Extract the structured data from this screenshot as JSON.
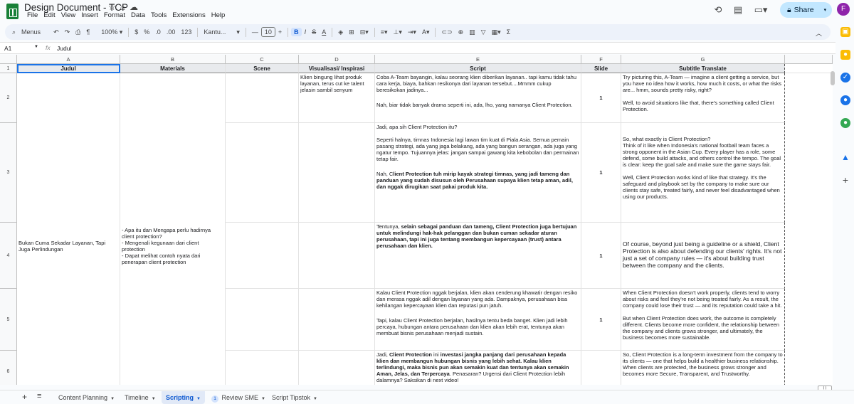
{
  "app": {
    "title": "Design Document - TCP",
    "menu": [
      "File",
      "Edit",
      "View",
      "Insert",
      "Format",
      "Data",
      "Tools",
      "Extensions",
      "Help"
    ],
    "share_label": "Share",
    "avatar_letter": "F"
  },
  "toolbar": {
    "menus_label": "Menus",
    "zoom": "100%",
    "currency": "$",
    "percent": "%",
    "dec_decrease": ".0",
    "dec_increase": ".00",
    "number_format": "123",
    "font_name": "Kantu...",
    "font_size": "10",
    "minus": "—",
    "plus": "+",
    "bold": "B",
    "italic": "I",
    "strike": "S",
    "textcolor": "A",
    "sigma": "Σ"
  },
  "formula_bar": {
    "cell_ref": "A1",
    "fx": "fx",
    "value": "Judul"
  },
  "columns": [
    "A",
    "B",
    "C",
    "D",
    "E",
    "F",
    "G"
  ],
  "headers": [
    "Judul",
    "Materials",
    "Scene",
    "Visualisasi/ Inspirasi",
    "Script",
    "Slide",
    "Subtitle Translate"
  ],
  "rows": [
    "1",
    "2",
    "3",
    "4",
    "5",
    "6"
  ],
  "cells": {
    "a_judul": "Bukan Cuma Sekadar Layanan, Tapi Juga Perlindungan",
    "b_materials": "- Apa itu dan Mengapa perlu hadirnya client protection?\n- Mengenali kegunaan dari client protection\n- Dapat melihat contoh nyata dari penerapan client protection",
    "d_visual": "Klien bingung lihat produk layanan, terus cut ke talent jelasin sambil senyum",
    "r2_script_p1": "Coba A-Team bayangin, kalau seorang klien diberikan layanan.. tapi kamu tidak tahu cara kerja, biaya, bahkan resikonya dari layanan tersebut....Mmmm cukup beresikokan jadinya...",
    "r2_script_p2": "Nah, biar tidak banyak drama seperti ini, ada, lho, yang namanya Client Protection.",
    "r2_slide": "1",
    "r2_sub_p1": "Try picturing this, A-Team — imagine a client getting a service, but you have no idea how it works, how much it costs, or what the risks are... hmm, sounds pretty risky, right?",
    "r2_sub_p2": "Well, to avoid situations like that, there's something called Client Protection.",
    "r3_script_p1": "Jadi, apa sih Client Protection itu?",
    "r3_script_p2": "Seperti halnya, timnas Indonesia lagi lawan tim kuat di Piala Asia. Semua pemain pasang strategi, ada yang jaga belakang, ada yang bangun serangan, ada juga yang ngatur tempo. Tujuannya jelas: jangan sampai gawang kita kebobolan dan permainan tetap fair.",
    "r3_script_p3a": "Nah, C",
    "r3_script_p3b": "lient Protection tuh mirip kayak strategi timnas, yang jadi tameng dan panduan yang sudah disusun oleh Perusahaan supaya klien tetap aman, adil, dan nggak dirugikan saat pakai produk kita.",
    "r3_slide": "1",
    "r3_sub_p1": "So, what exactly is Client Protection?\nThink of it like when Indonesia's national football team faces a strong opponent in the Asian Cup. Every player has a role, some defend, some build attacks, and others control the tempo. The goal is clear: keep the goal safe and make sure the game stays fair.",
    "r3_sub_p2": "Well, Client Protection works kind of like that strategy. It's the safeguard and playbook set by the company to make sure our clients stay safe, treated fairly, and never feel disadvantaged when using our products.",
    "r4_script_a": "Tentunya, ",
    "r4_script_b": "selain sebagai panduan dan tameng, Client Protection juga bertujuan untuk melindungi hak-hak pelanggan dan bukan cuman sekadar aturan perusahaan, tapi ini juga tentang membangun kepercayaan (trust) antara perusahaan dan klien.",
    "r4_slide": "1",
    "r4_sub": "Of course, beyond just being a guideline or a shield, Client Protection is also about defending our clients' rights. It's not just a set of company rules — it's about building trust between the company and the clients.",
    "r5_script_p1": "Kalau Client Protection nggak berjalan, klien akan cenderung khawatir dengan resiko dan merasa nggak adil dengan layanan yang ada. Dampaknya, perusahaan bisa kehilangan kepercayaan klien dan reputasi pun jatuh.",
    "r5_script_p2": "Tapi, kalau Client Protection berjalan, hasilnya tentu beda banget. Klien jadi lebih percaya, hubungan antara perusahaan dan klien akan lebih erat, tentunya akan membuat bisnis perusahaan menjadi sustain.",
    "r5_slide": "1",
    "r5_sub_p1": "When Client Protection doesn't work properly, clients tend to worry about risks and feel they're not being treated fairly. As a result, the company could lose their trust — and its reputation could take a hit.",
    "r5_sub_p2": "But when Client Protection does work, the outcome is completely different. Clients become more confident, the relationship between the company and clients grows stronger, and ultimately, the business becomes more sustainable.",
    "r6_script_a": "Jadi, ",
    "r6_script_b": "Client Protection",
    "r6_script_c": " ini ",
    "r6_script_d": "investasi jangka panjang dari perusahaan kepada klien dan membangun hubungan bisnis yang lebih sehat. Kalau klien terlindungi, maka bisnis pun akan semakin kuat dan tentunya akan semakin Aman, Jelas, dan Terpercaya",
    "r6_script_e": ". Penasaran? Urgensi dari Client Protection lebih dalamnya? Saksikan di next video!",
    "r6_slide": "1",
    "r6_sub": "So, Client Protection is a long-term investment from the company to its clients — one that helps build a healthier business relationship. When clients are protected, the business grows stronger and becomes more Secure, Transparent, and Trustworthy."
  },
  "sheets": {
    "add": "+",
    "list": "≡",
    "tabs": [
      {
        "label": "Content Planning"
      },
      {
        "label": "Timeline"
      },
      {
        "label": "Scripting"
      },
      {
        "label": "Review SME",
        "badge": "1"
      },
      {
        "label": "Script Tipstok"
      }
    ]
  },
  "colors": {
    "accent": "#1a73e8",
    "share_bg": "#c2e7ff",
    "sheets_green": "#188038",
    "avatar": "#8e24aa"
  },
  "icons": [
    "star-icon",
    "move-icon",
    "cloud-status-icon",
    "history-icon",
    "comments-icon",
    "meet-icon",
    "search-icon",
    "undo-icon",
    "redo-icon",
    "print-icon",
    "paint-format-icon"
  ]
}
